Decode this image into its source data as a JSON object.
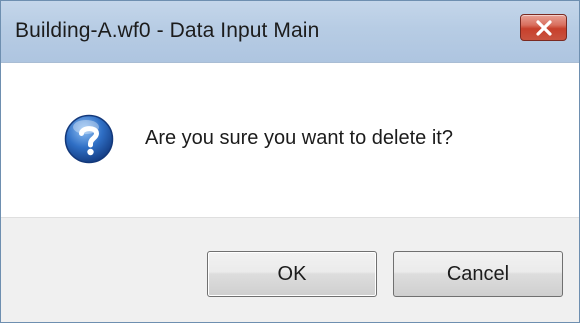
{
  "dialog": {
    "title": "Building-A.wf0 - Data Input Main",
    "message": "Are you sure you want to delete it?",
    "icon": "question-icon",
    "buttons": {
      "ok_label": "OK",
      "cancel_label": "Cancel"
    },
    "close_icon": "close-icon"
  },
  "colors": {
    "titlebar": "#b9cee6",
    "close_button": "#c7402c",
    "question_icon": "#1f5fb4",
    "footer": "#f0f0f0"
  }
}
